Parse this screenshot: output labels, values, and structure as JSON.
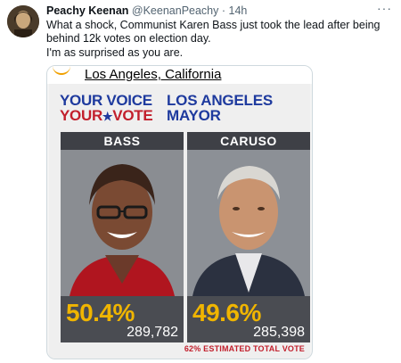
{
  "tweet": {
    "author_name": "Peachy Keenan",
    "author_handle": "@KeenanPeachy",
    "separator": "·",
    "timestamp": "14h",
    "more_icon": "more-dots-icon",
    "text_line1": "What a shock, Communist Karen Bass just took the lead after being behind 12k votes on election day.",
    "text_line2": "I'm as surprised as you are."
  },
  "graphic": {
    "location": "Los Angeles, California",
    "brand_line1": "YOUR VOICE",
    "brand_line2_a": "YOUR",
    "brand_line2_b": "VOTE",
    "race_line1": "LOS ANGELES",
    "race_line2": "MAYOR",
    "colors": {
      "blue": "#1e3a9e",
      "red": "#c21f2c",
      "gold": "#f0b500"
    },
    "candidates": [
      {
        "name": "BASS",
        "percent": "50.4%",
        "votes": "289,782"
      },
      {
        "name": "CARUSO",
        "percent": "49.6%",
        "votes": "285,398"
      }
    ],
    "estimated": "62% ESTIMATED TOTAL VOTE"
  }
}
